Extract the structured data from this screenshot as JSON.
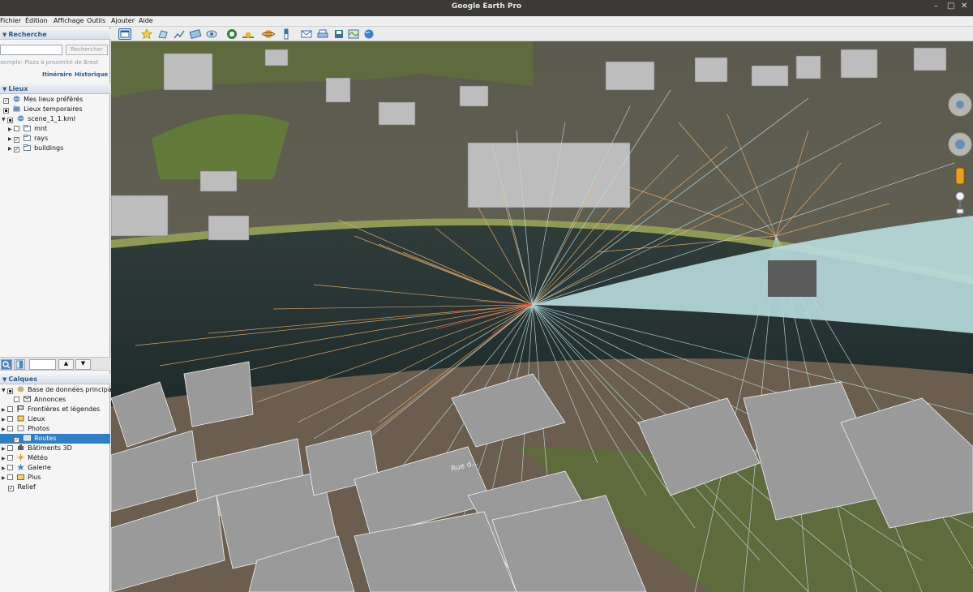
{
  "window": {
    "title": "Google Earth Pro"
  },
  "menu": [
    "Fichier",
    "Édition",
    "Affichage",
    "Outils",
    "Ajouter",
    "Aide"
  ],
  "search": {
    "header": "Recherche",
    "button": "Rechercher",
    "hint": "xemple: Pizza à proximité de Brest",
    "links": [
      "Itinéraire",
      "Historique"
    ]
  },
  "places": {
    "header": "Lieux",
    "items": [
      {
        "label": "Mes lieux préférés",
        "checked": true
      },
      {
        "label": "Lieux temporaires",
        "checked": false
      },
      {
        "label": "scene_1_1.kml",
        "checked": false
      },
      {
        "label": "mnt",
        "checked": false
      },
      {
        "label": "rays",
        "checked": true
      },
      {
        "label": "buildings",
        "checked": true
      }
    ]
  },
  "layers": {
    "header": "Calques",
    "items": [
      {
        "label": "Base de données principale",
        "checked": false
      },
      {
        "label": "Annonces",
        "checked": false
      },
      {
        "label": "Frontières et légendes",
        "checked": false
      },
      {
        "label": "Lieux",
        "checked": false
      },
      {
        "label": "Photos",
        "checked": false
      },
      {
        "label": "Routes",
        "checked": true,
        "selected": true
      },
      {
        "label": "Bâtiments 3D",
        "checked": false
      },
      {
        "label": "Météo",
        "checked": false
      },
      {
        "label": "Galerie",
        "checked": false
      },
      {
        "label": "Plus",
        "checked": false
      },
      {
        "label": "Relief",
        "checked": true
      }
    ]
  },
  "map": {
    "street_label": "Rue d..."
  },
  "colors": {
    "accent": "#2f7fc7",
    "header_text": "#2d5a8f",
    "ray_blue": "#b9dde0",
    "ray_orange": "#f4b870",
    "building": "#9a9a9a"
  }
}
